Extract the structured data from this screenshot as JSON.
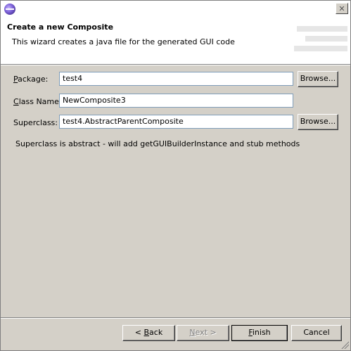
{
  "dialog": {
    "header_title": "Create a new Composite",
    "header_description": "This wizard creates a java file for the generated GUI code"
  },
  "form": {
    "package_label_mnemonic": "P",
    "package_label_rest": "ackage:",
    "package_value": "test4",
    "classname_label_mnemonic": "C",
    "classname_label_rest": "lass Name:",
    "classname_value": "NewComposite3",
    "superclass_label": "Superclass:",
    "superclass_value": "test4.AbstractParentComposite",
    "browse_label": "Browse...",
    "info_message": "Superclass is abstract - will add getGUIBuilderInstance and stub methods"
  },
  "footer": {
    "back_prefix": "< ",
    "back_mnemonic": "B",
    "back_rest": "ack",
    "next_mnemonic": "N",
    "next_rest": "ext >",
    "finish_mnemonic": "F",
    "finish_rest": "inish",
    "cancel_label": "Cancel"
  },
  "icons": {
    "app": "eclipse-icon",
    "close": "close-icon"
  }
}
